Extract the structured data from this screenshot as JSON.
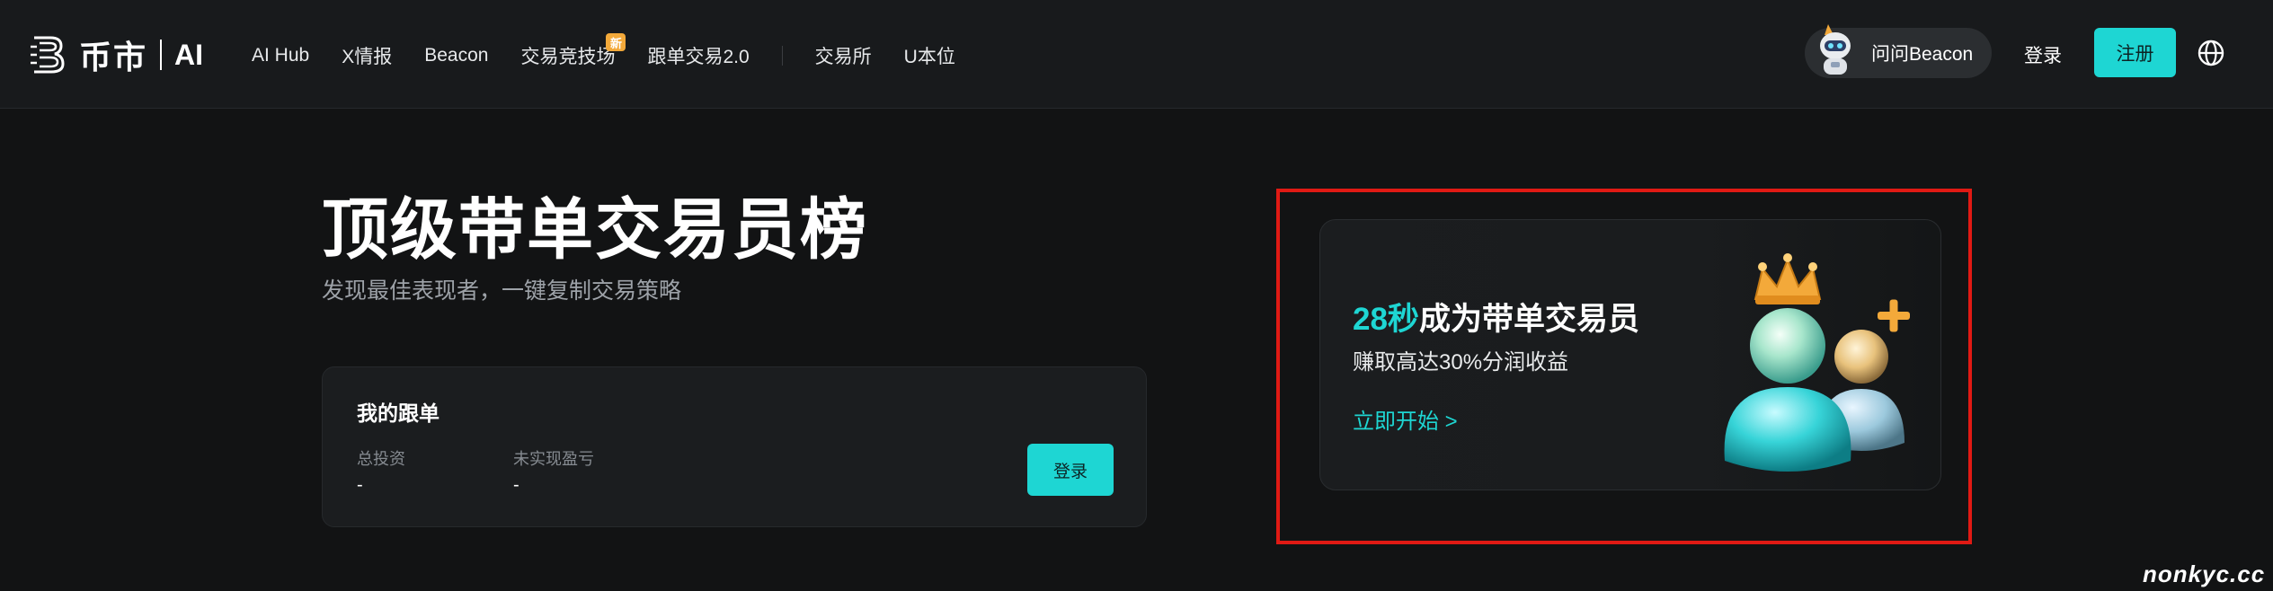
{
  "nav": {
    "brand_cn": "币市",
    "brand_ai": "AI",
    "links": [
      {
        "label": "AI Hub"
      },
      {
        "label": "X情报"
      },
      {
        "label": "Beacon"
      },
      {
        "label": "交易竞技场",
        "badge": "新"
      },
      {
        "label": "跟单交易2.0"
      },
      {
        "label": "交易所"
      },
      {
        "label": "U本位"
      }
    ],
    "ask_beacon": "问问Beacon",
    "login": "登录",
    "register": "注册",
    "icons": {
      "language": "globe-icon",
      "brand": "logo-mark-icon",
      "assistant": "beacon-avatar-icon"
    }
  },
  "hero": {
    "title": "顶级带单交易员榜",
    "subtitle": "发现最佳表现者，一键复制交易策略"
  },
  "my_follow": {
    "title": "我的跟单",
    "total_investment_label": "总投资",
    "total_investment_value": "-",
    "unrealized_pnl_label": "未实现盈亏",
    "unrealized_pnl_value": "-",
    "login_button": "登录"
  },
  "promo": {
    "headline_accent": "28秒",
    "headline_rest": "成为带单交易员",
    "subtext": "赚取高达30%分润收益",
    "cta": "立即开始 >",
    "illustration": "traders-crown-plus-icon"
  },
  "watermark": "nonkyc.cc",
  "colors": {
    "accent": "#1ed6d3",
    "background": "#121314",
    "nav_background": "#181a1c",
    "badge": "#f3a93a",
    "highlight": "#e01a14"
  }
}
